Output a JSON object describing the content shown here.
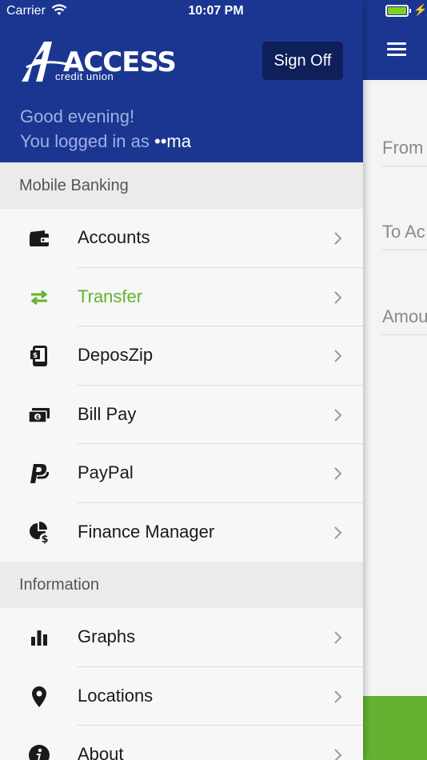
{
  "status_bar": {
    "carrier": "Carrier",
    "time": "10:07 PM"
  },
  "drawer": {
    "logo": {
      "wordmark": "ACCESS",
      "subtitle": "credit union"
    },
    "sign_off_label": "Sign Off",
    "greeting": "Good evening!",
    "logged_in_prefix": "You logged in as ",
    "username": "••ma",
    "sections": [
      {
        "title": "Mobile Banking",
        "items": [
          {
            "label": "Accounts",
            "icon": "wallet-icon",
            "active": false
          },
          {
            "label": "Transfer",
            "icon": "transfer-arrows-icon",
            "active": true
          },
          {
            "label": "DeposZip",
            "icon": "mobile-deposit-icon",
            "active": false
          },
          {
            "label": "Bill Pay",
            "icon": "bill-pay-icon",
            "active": false
          },
          {
            "label": "PayPal",
            "icon": "paypal-icon",
            "active": false
          },
          {
            "label": "Finance Manager",
            "icon": "finance-manager-icon",
            "active": false
          }
        ]
      },
      {
        "title": "Information",
        "items": [
          {
            "label": "Graphs",
            "icon": "bar-chart-icon",
            "active": false
          },
          {
            "label": "Locations",
            "icon": "location-pin-icon",
            "active": false
          },
          {
            "label": "About",
            "icon": "info-icon",
            "active": false
          }
        ]
      }
    ]
  },
  "background_form": {
    "fields": [
      "From",
      "To Ac",
      "Amou"
    ]
  },
  "colors": {
    "header_blue": "#1b3691",
    "sign_off_bg": "#0e1f5a",
    "accent_green": "#63b231",
    "section_bg": "#ebebeb",
    "item_bg": "#f7f7f7"
  }
}
